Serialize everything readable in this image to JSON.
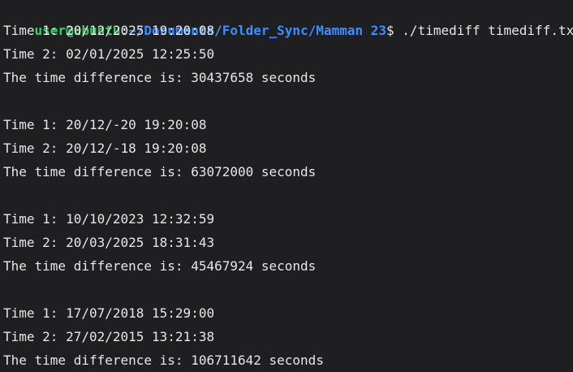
{
  "prompt": {
    "user_host": "user@ubuntu",
    "colon": ":",
    "path": "~/Documents/Folder_Sync/Mamman 23",
    "dollar": "$ ",
    "command": "./timediff timediff.txt"
  },
  "output": {
    "block1": {
      "time1": "Time 1: 20/12/2025 19:20:08",
      "time2": "Time 2: 02/01/2025 12:25:50",
      "diff": "The time difference is: 30437658 seconds"
    },
    "block2": {
      "time1": "Time 1: 20/12/-20 19:20:08",
      "time2": "Time 2: 20/12/-18 19:20:08",
      "diff": "The time difference is: 63072000 seconds"
    },
    "block3": {
      "time1": "Time 1: 10/10/2023 12:32:59",
      "time2": "Time 2: 20/03/2025 18:31:43",
      "diff": "The time difference is: 45467924 seconds"
    },
    "block4": {
      "time1": "Time 1: 17/07/2018 15:29:00",
      "time2": "Time 2: 27/02/2015 13:21:38",
      "diff": "The time difference is: 106711642 seconds"
    }
  },
  "colors": {
    "background": "#1f1f21",
    "user_host": "#2fd16b",
    "path": "#3b8fff",
    "text": "#e6e6e6"
  }
}
